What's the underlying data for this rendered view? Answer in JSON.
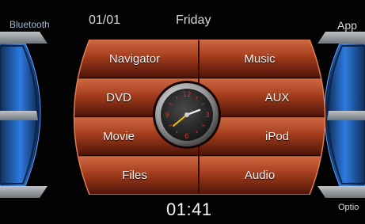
{
  "status_bar": {
    "bluetooth_label": "Bluetooth",
    "date": "01/01",
    "day": "Friday",
    "app_label": "App",
    "options_label": "Optio"
  },
  "menu": {
    "items": [
      {
        "label": "Navigator"
      },
      {
        "label": "Music"
      },
      {
        "label": "DVD"
      },
      {
        "label": "AUX"
      },
      {
        "label": "Movie"
      },
      {
        "label": "iPod"
      },
      {
        "label": "Files"
      },
      {
        "label": "Audio"
      }
    ]
  },
  "clock": {
    "time_text": "01:41"
  },
  "colors": {
    "menu_red": "#8f2c14",
    "menu_red_light": "#c9613f",
    "side_blue": "#1f67c8",
    "background": "#020202"
  }
}
